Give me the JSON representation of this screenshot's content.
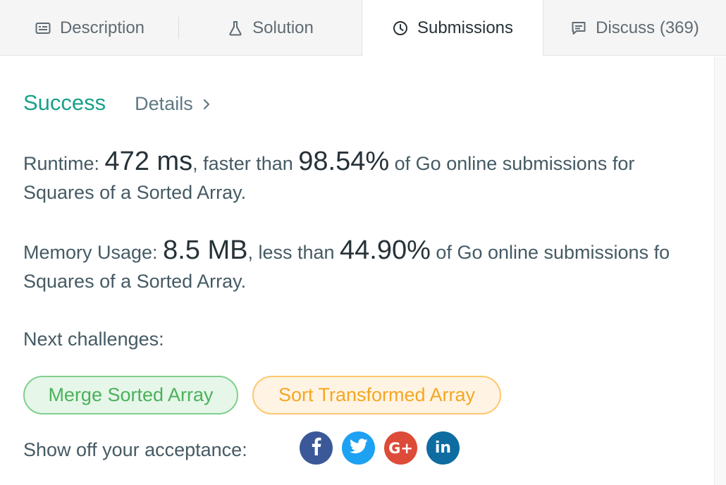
{
  "tabs": [
    {
      "label": "Description",
      "icon": "description-icon"
    },
    {
      "label": "Solution",
      "icon": "flask-icon"
    },
    {
      "label": "Submissions",
      "icon": "clock-icon"
    },
    {
      "label": "Discuss (369)",
      "icon": "comment-icon"
    }
  ],
  "result": {
    "status": "Success",
    "details_label": "Details"
  },
  "runtime": {
    "label": "Runtime: ",
    "value": "472 ms",
    "mid": ", faster than ",
    "percent": "98.54%",
    "tail": " of Go online submissions for",
    "problem": "Squares of a Sorted Array."
  },
  "memory": {
    "label": "Memory Usage: ",
    "value": "8.5 MB",
    "mid": ", less than ",
    "percent": "44.90%",
    "tail": " of Go online submissions fo",
    "problem": "Squares of a Sorted Array."
  },
  "next": {
    "label": "Next challenges:",
    "challenges": [
      {
        "label": "Merge Sorted Array",
        "color": "#4bb15b"
      },
      {
        "label": "Sort Transformed Array",
        "color": "#f5a623"
      }
    ]
  },
  "share": {
    "label": "Show off your acceptance:",
    "buttons": [
      {
        "name": "facebook",
        "glyph": "f",
        "color": "#3b5998"
      },
      {
        "name": "twitter",
        "glyph": "",
        "color": "#1da1f2"
      },
      {
        "name": "google-plus",
        "glyph": "G+",
        "color": "#dd4b39"
      },
      {
        "name": "linkedin",
        "glyph": "in",
        "color": "#0e6ca0"
      }
    ]
  },
  "colors": {
    "success": "#18a08a",
    "accent_text": "#263238"
  }
}
